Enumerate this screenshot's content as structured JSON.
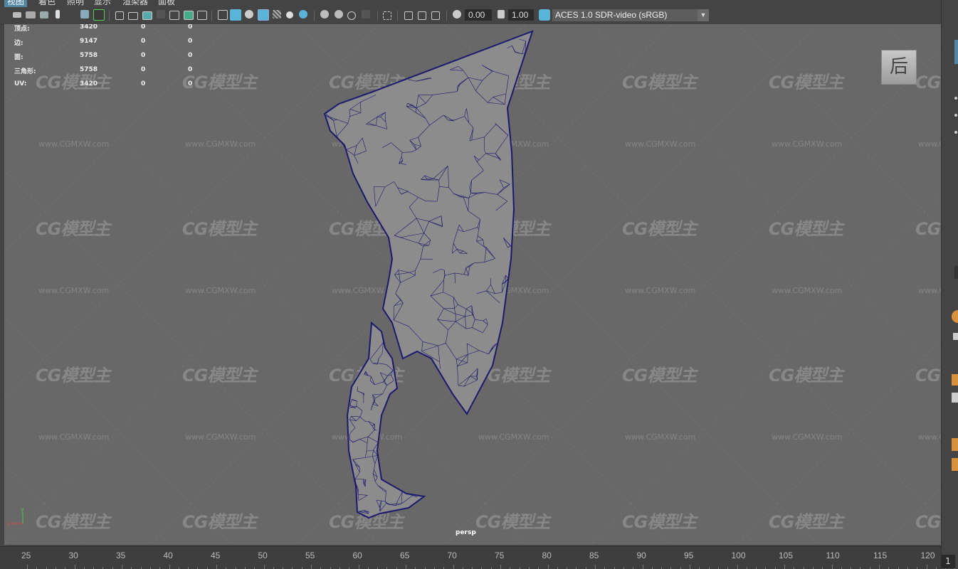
{
  "menu": {
    "items": [
      {
        "label": "视图",
        "active": true
      },
      {
        "label": "着色",
        "active": false
      },
      {
        "label": "照明",
        "active": false
      },
      {
        "label": "显示",
        "active": false
      },
      {
        "label": "渲染器",
        "active": false
      },
      {
        "label": "面板",
        "active": false
      }
    ]
  },
  "toolbar": {
    "exposure_value": "0.00",
    "gamma_value": "1.00",
    "color_management": "ACES 1.0 SDR-video (sRGB)"
  },
  "hud": {
    "rows": [
      {
        "label": "顶点:",
        "values": [
          "3420",
          "0",
          "0"
        ]
      },
      {
        "label": "边:",
        "values": [
          "9147",
          "0",
          "0"
        ]
      },
      {
        "label": "面:",
        "values": [
          "5758",
          "0",
          "0"
        ]
      },
      {
        "label": "三角形:",
        "values": [
          "5758",
          "0",
          "0"
        ]
      },
      {
        "label": "UV:",
        "values": [
          "3420",
          "0",
          "0"
        ]
      }
    ]
  },
  "viewport": {
    "camera_label": "persp",
    "viewcube_label": "后",
    "axis_labels": {
      "y": "y",
      "x": "x"
    },
    "wire_color": "#1a1a6e",
    "mesh_fill": "#8c8c8c"
  },
  "watermark": {
    "logo": "CG模型主",
    "url": "www.CGMXW.com"
  },
  "timeline": {
    "ticks": [
      "25",
      "30",
      "35",
      "40",
      "45",
      "50",
      "55",
      "60",
      "65",
      "70",
      "75",
      "80",
      "85",
      "90",
      "95",
      "100",
      "105",
      "110",
      "115",
      "120"
    ],
    "current_frame": "1"
  }
}
